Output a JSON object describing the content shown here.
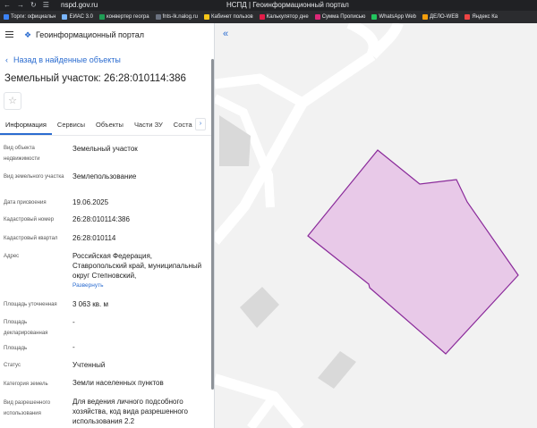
{
  "browser": {
    "url": "nspd.gov.ru",
    "window_title": "НСПД | Геоинформационный портал",
    "bookmarks": [
      {
        "label": "Торги: официальн",
        "color": "#3b82f6"
      },
      {
        "label": "ЕИАС 3.0",
        "color": "#7ab6ff"
      },
      {
        "label": "конвертер геогра",
        "color": "#1f9d55"
      },
      {
        "label": "fnts-lk.nalog.ru",
        "color": "#6b7280"
      },
      {
        "label": "Кабинет пользов",
        "color": "#f5c518"
      },
      {
        "label": "Калькулятор дне",
        "color": "#e11d48"
      },
      {
        "label": "Сумма Прописью",
        "color": "#db2777"
      },
      {
        "label": "WhatsApp Web",
        "color": "#22c55e"
      },
      {
        "label": "ДЕЛО-WEB",
        "color": "#f59e0b"
      },
      {
        "label": "Яндекс Ка",
        "color": "#ef4444"
      }
    ]
  },
  "header": {
    "title": "Геоинформационный портал"
  },
  "back_link": "Назад в найденные объекты",
  "object_title": "Земельный участок: 26:28:010114:386",
  "tabs": [
    "Информация",
    "Сервисы",
    "Объекты",
    "Части ЗУ",
    "Соста"
  ],
  "attributes": [
    {
      "label": "Вид объекта недвижимости",
      "value": "Земельный участок"
    },
    {
      "label": "Вид земельного участка",
      "value": "Землепользование"
    },
    {
      "label": "Дата присвоения",
      "value": "19.06.2025"
    },
    {
      "label": "Кадастровый номер",
      "value": "26:28:010114:386"
    },
    {
      "label": "Кадастровый квартал",
      "value": "26:28:010114"
    },
    {
      "label": "Адрес",
      "value": "Российская Федерация, Ставропольский край, муниципальный округ Степновский,"
    },
    {
      "label": "Площадь уточненная",
      "value": "3 063 кв. м"
    },
    {
      "label": "Площадь декларированная",
      "value": "-"
    },
    {
      "label": "Площадь",
      "value": "-"
    },
    {
      "label": "Статус",
      "value": "Учтенный"
    },
    {
      "label": "Категория земель",
      "value": "Земли населенных пунктов"
    },
    {
      "label": "Вид разрешенного использования",
      "value": "Для ведения личного подсобного хозяйства, код вида разрешенного использования 2.2"
    }
  ],
  "expand_link": "Развернуть",
  "colors": {
    "accent": "#2b6cd0",
    "parcel_fill": "#e8c9e8",
    "parcel_stroke": "#8a2a9a",
    "map_bg": "#f2f2f2",
    "building": "#d9d9d9"
  }
}
